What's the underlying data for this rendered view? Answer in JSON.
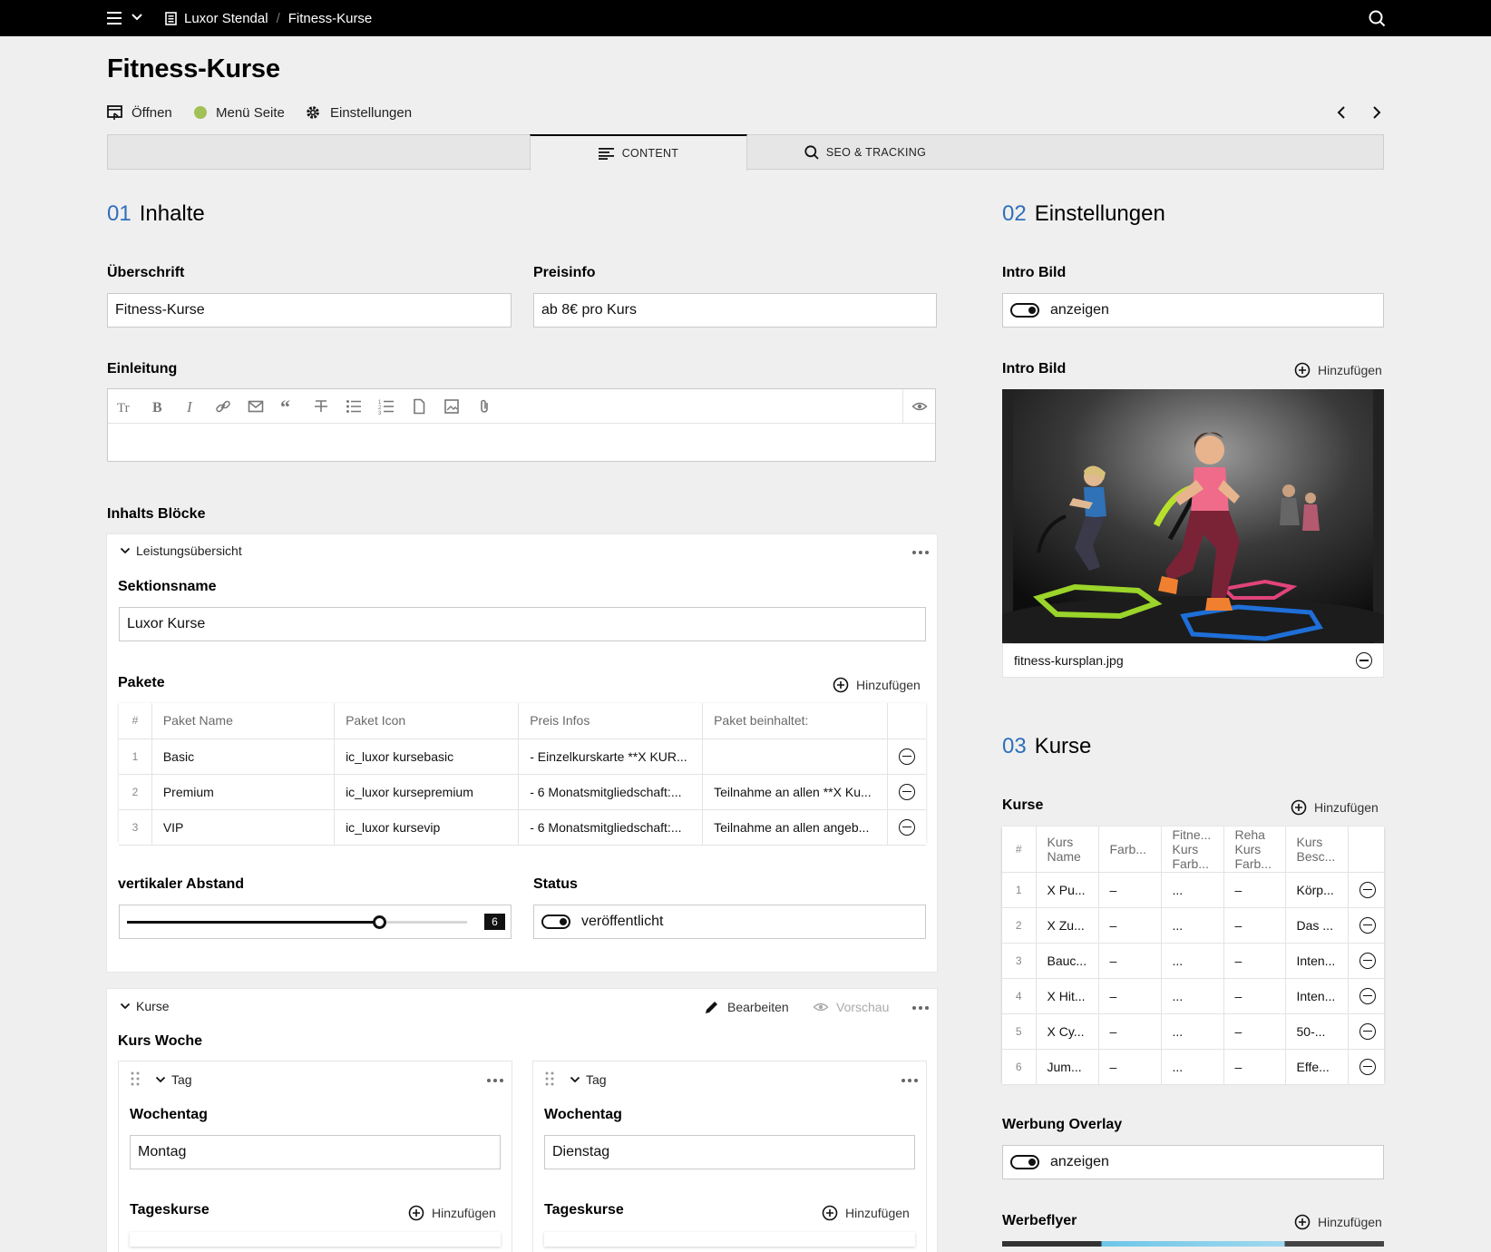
{
  "breadcrumb": {
    "site": "Luxor Stendal",
    "page": "Fitness-Kurse"
  },
  "page_title": "Fitness-Kurse",
  "header_actions": {
    "open": "Öffnen",
    "menu_page": "Menü Seite",
    "settings": "Einstellungen"
  },
  "status_dot_color": "#a1c055",
  "accent_color": "#2f6fba",
  "tabs": [
    {
      "label": "CONTENT"
    },
    {
      "label": "SEO & TRACKING"
    }
  ],
  "sections": {
    "s1": {
      "num": "01",
      "title": "Inhalte"
    },
    "s2": {
      "num": "02",
      "title": "Einstellungen"
    },
    "s3": {
      "num": "03",
      "title": "Kurse"
    }
  },
  "fields": {
    "ueberschrift": {
      "label": "Überschrift",
      "value": "Fitness-Kurse"
    },
    "preisinfo": {
      "label": "Preisinfo",
      "value": "ab 8€ pro Kurs"
    },
    "einleitung": {
      "label": "Einleitung"
    },
    "inhalts_bloecke": {
      "label": "Inhalts Blöcke"
    }
  },
  "block1": {
    "title": "Leistungsübersicht",
    "sektionsname_label": "Sektionsname",
    "sektionsname_value": "Luxor Kurse",
    "pakete_label": "Pakete",
    "add": "Hinzufügen",
    "columns": [
      "#",
      "Paket Name",
      "Paket Icon",
      "Preis Infos",
      "Paket beinhaltet:"
    ],
    "rows": [
      [
        "1",
        "Basic",
        "ic_luxor kursebasic",
        "- Einzelkurskarte **X KUR...",
        ""
      ],
      [
        "2",
        "Premium",
        "ic_luxor kursepremium",
        "- 6 Monatsmitgliedschaft:...",
        "Teilnahme an allen **X Ku..."
      ],
      [
        "3",
        "VIP",
        "ic_luxor kursevip",
        "- 6 Monatsmitgliedschaft:...",
        "Teilnahme an allen angeb..."
      ]
    ],
    "abstand_label": "vertikaler Abstand",
    "abstand_value": "6",
    "abstand_fraction": 0.74,
    "status_label": "Status",
    "status_value": "veröffentlicht"
  },
  "block2": {
    "title": "Kurse",
    "edit": "Bearbeiten",
    "preview": "Vorschau",
    "kurs_woche_label": "Kurs Woche",
    "days": [
      {
        "title": "Tag",
        "wochentag_label": "Wochentag",
        "wochentag_value": "Montag",
        "tageskurse_label": "Tageskurse",
        "add": "Hinzufügen"
      },
      {
        "title": "Tag",
        "wochentag_label": "Wochentag",
        "wochentag_value": "Dienstag",
        "tageskurse_label": "Tageskurse",
        "add": "Hinzufügen"
      }
    ]
  },
  "settings": {
    "intro_bild_toggle_label": "Intro Bild",
    "intro_bild_toggle_value": "anzeigen",
    "intro_bild_label": "Intro Bild",
    "add": "Hinzufügen",
    "image_filename": "fitness-kursplan.jpg"
  },
  "kurse": {
    "label": "Kurse",
    "add": "Hinzufügen",
    "columns": [
      "#",
      "Kurs Name",
      "Farb...",
      "Fitne... Kurs Farb...",
      "Reha Kurs Farb...",
      "Kurs Besc..."
    ],
    "rows": [
      [
        "1",
        "X Pu...",
        "–",
        "...",
        "–",
        "Körp..."
      ],
      [
        "2",
        "X Zu...",
        "–",
        "...",
        "–",
        "Das ..."
      ],
      [
        "3",
        "Bauc...",
        "–",
        "...",
        "–",
        "Inten..."
      ],
      [
        "4",
        "X Hit...",
        "–",
        "...",
        "–",
        "Inten..."
      ],
      [
        "5",
        "X Cy...",
        "–",
        "...",
        "–",
        "50-..."
      ],
      [
        "6",
        "Jum...",
        "–",
        "...",
        "–",
        "Effe..."
      ]
    ]
  },
  "werbung": {
    "label": "Werbung Overlay",
    "value": "anzeigen"
  },
  "werbeflyer": {
    "label": "Werbeflyer",
    "add": "Hinzufügen"
  }
}
